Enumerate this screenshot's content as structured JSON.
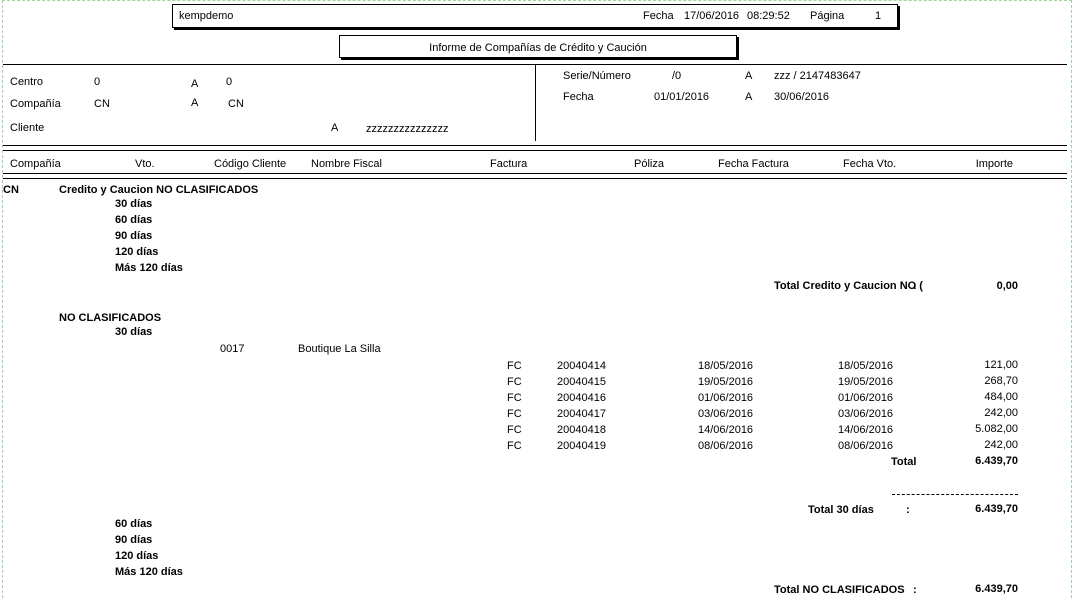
{
  "header": {
    "user": "kempdemo",
    "fecha_label": "Fecha",
    "fecha": "17/06/2016",
    "hora": "08:29:52",
    "pagina_label": "Página",
    "pagina": "1"
  },
  "report_title": "Informe de Compañías de Crédito y Caución",
  "filters": {
    "centro_label": "Centro",
    "centro_from": "0",
    "centro_a": "A",
    "centro_to": "0",
    "compania_label": "Compañía",
    "compania_from": "CN",
    "compania_a": "A",
    "compania_to": "CN",
    "cliente_label": "Cliente",
    "cliente_a": "A",
    "cliente_to": "zzzzzzzzzzzzzzz",
    "serie_label": "Serie/Número",
    "serie_from": "/0",
    "serie_a": "A",
    "serie_to": "zzz  /  2147483647",
    "fecha_label": "Fecha",
    "fecha_from": "01/01/2016",
    "fecha_a": "A",
    "fecha_to": "30/06/2016"
  },
  "columns": {
    "compania": "Compañía",
    "vto": "Vto.",
    "codigo": "Código Cliente",
    "nombre": "Nombre Fiscal",
    "factura": "Factura",
    "poliza": "Póliza",
    "fecha_factura": "Fecha Factura",
    "fecha_vto": "Fecha Vto.",
    "importe": "Importe"
  },
  "body": {
    "company": "CN",
    "group1": {
      "title": "Credito y Caucion NO CLASIFICADOS",
      "ranges": [
        "30 días",
        "60 días",
        "90 días",
        "120 días",
        "Más 120 días"
      ],
      "total_label": "Total  Credito y Caucion NO (",
      "total_colon": ":",
      "total_value": "0,00"
    },
    "group2": {
      "title": "NO CLASIFICADOS",
      "range_30": "30 días",
      "client_code": "0017",
      "client_name": "Boutique La Silla",
      "invoices": [
        {
          "tipo": "FC",
          "numero": "20040414",
          "fecha_factura": "18/05/2016",
          "fecha_vto": "18/05/2016",
          "importe": "121,00"
        },
        {
          "tipo": "FC",
          "numero": "20040415",
          "fecha_factura": "19/05/2016",
          "fecha_vto": "19/05/2016",
          "importe": "268,70"
        },
        {
          "tipo": "FC",
          "numero": "20040416",
          "fecha_factura": "01/06/2016",
          "fecha_vto": "01/06/2016",
          "importe": "484,00"
        },
        {
          "tipo": "FC",
          "numero": "20040417",
          "fecha_factura": "03/06/2016",
          "fecha_vto": "03/06/2016",
          "importe": "242,00"
        },
        {
          "tipo": "FC",
          "numero": "20040418",
          "fecha_factura": "14/06/2016",
          "fecha_vto": "14/06/2016",
          "importe": "5.082,00"
        },
        {
          "tipo": "FC",
          "numero": "20040419",
          "fecha_factura": "08/06/2016",
          "fecha_vto": "08/06/2016",
          "importe": "242,00"
        }
      ],
      "client_total_label": "Total",
      "client_total_value": "6.439,70",
      "total_30_label": "Total  30 días",
      "total_30_colon": ":",
      "total_30_value": "6.439,70",
      "other_ranges": [
        "60 días",
        "90 días",
        "120 días",
        "Más 120 días"
      ],
      "total_label": "Total  NO CLASIFICADOS",
      "total_colon": ":",
      "total_value": "6.439,70"
    }
  }
}
